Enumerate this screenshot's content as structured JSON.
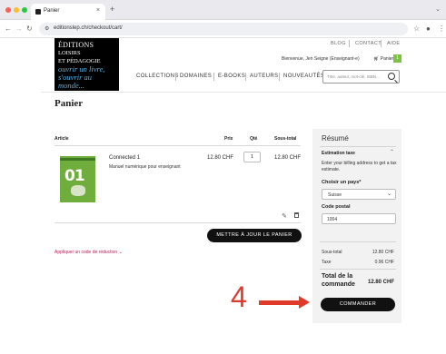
{
  "browser": {
    "tab_title": "Panier",
    "url": "editionslep.ch/checkout/cart/",
    "colors": {
      "close": "#ff5f57",
      "minimize": "#febc2e",
      "maximize": "#28c840"
    }
  },
  "logo": {
    "line1": "ÉDITIONS",
    "line2": "LOISIRS",
    "line3": "ET PÉDAGOGIE",
    "slogan": "ouvrir un livre, s'ouvrir au monde..."
  },
  "header": {
    "top_links": [
      "BLOG",
      "CONTACT",
      "AIDE"
    ],
    "welcome": "Bienvenue, Jen Seigne (Enseignant-e)",
    "cart_label": "Panier",
    "cart_count": "1",
    "nav": [
      "COLLECTIONS",
      "DOMAINES",
      "E-BOOKS",
      "AUTEURS",
      "NOUVEAUTÉS"
    ],
    "search_placeholder": "Titre, auteur, mot-clé, ISBN..."
  },
  "cart": {
    "title": "Panier",
    "columns": [
      "Article",
      "Prix",
      "Qté",
      "Sous-total"
    ],
    "item": {
      "name": "Connected 1",
      "subtitle": "Manuel numérique pour enseignant",
      "cover_text": "01",
      "price": "12.80 CHF",
      "qty": "1",
      "subtotal": "12.80 CHF"
    },
    "update_label": "METTRE À JOUR LE PANIER",
    "coupon_label": "Appliquer un code de réduction"
  },
  "summary": {
    "title": "Résumé",
    "estimate_title": "Estimation taxe",
    "estimate_desc": "Enter your billing address to get a tax estimate.",
    "country_label": "Choisir un pays*",
    "country_value": "Suisse",
    "zip_label": "Code postal",
    "zip_value": "1004",
    "subtotal_label": "Sous-total",
    "subtotal_value": "12.80 CHF",
    "tax_label": "Taxe",
    "tax_value": "0.96 CHF",
    "total_label": "Total de la commande",
    "total_value": "12.80 CHF",
    "order_label": "COMMANDER"
  },
  "annotation": {
    "step": "4",
    "color": "#e03a2b"
  }
}
